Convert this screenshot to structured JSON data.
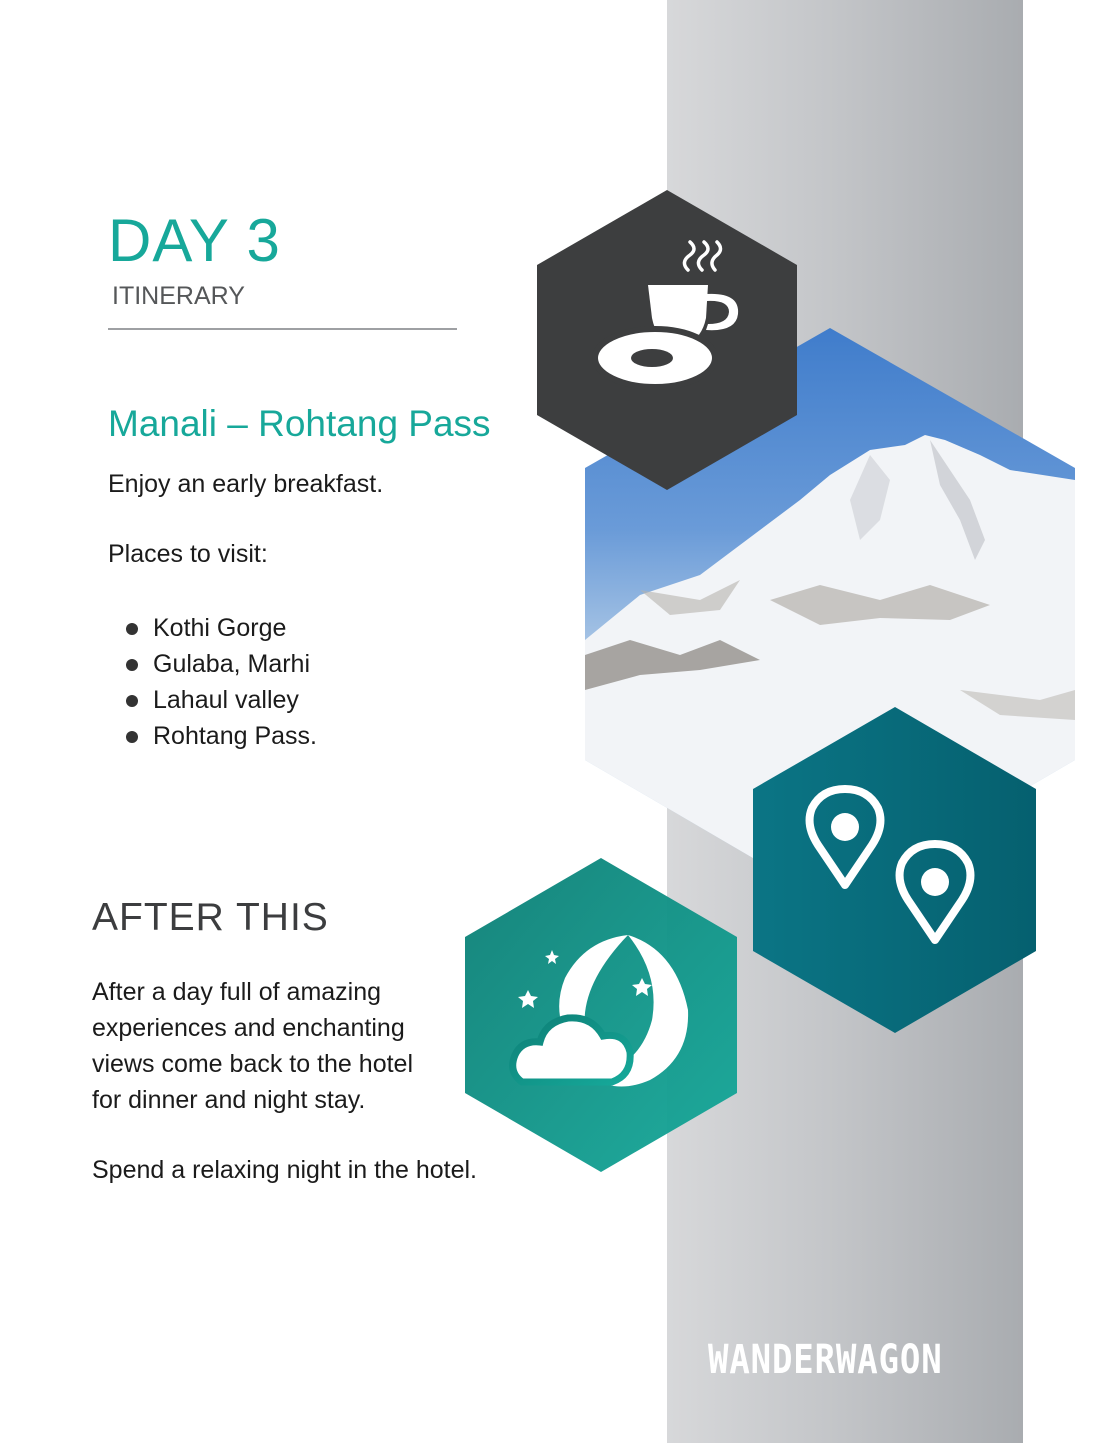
{
  "header": {
    "day": "DAY 3",
    "subtitle": "ITINERARY"
  },
  "route": {
    "title": "Manali – Rohtang Pass",
    "intro": "Enjoy an early breakfast.",
    "places_label": "Places to visit:",
    "places": [
      "Kothi Gorge",
      "Gulaba, Marhi",
      "Lahaul valley",
      "Rohtang Pass."
    ]
  },
  "after": {
    "title": "AFTER THIS",
    "lines": [
      "After a day full of amazing",
      "experiences and enchanting",
      "views come back to the hotel",
      "for dinner and night stay."
    ],
    "closing": "Spend a relaxing night in the hotel."
  },
  "brand": "WANDERWAGON",
  "icons": {
    "breakfast": "coffee-donut-icon",
    "places": "map-pin-icon",
    "night": "moon-cloud-icon"
  },
  "colors": {
    "accent": "#17a89a",
    "dark_hex": "#3d3e3f",
    "teal_hex": "#08697a",
    "night_hex": "#14a596",
    "band": "#c4c6c9"
  }
}
